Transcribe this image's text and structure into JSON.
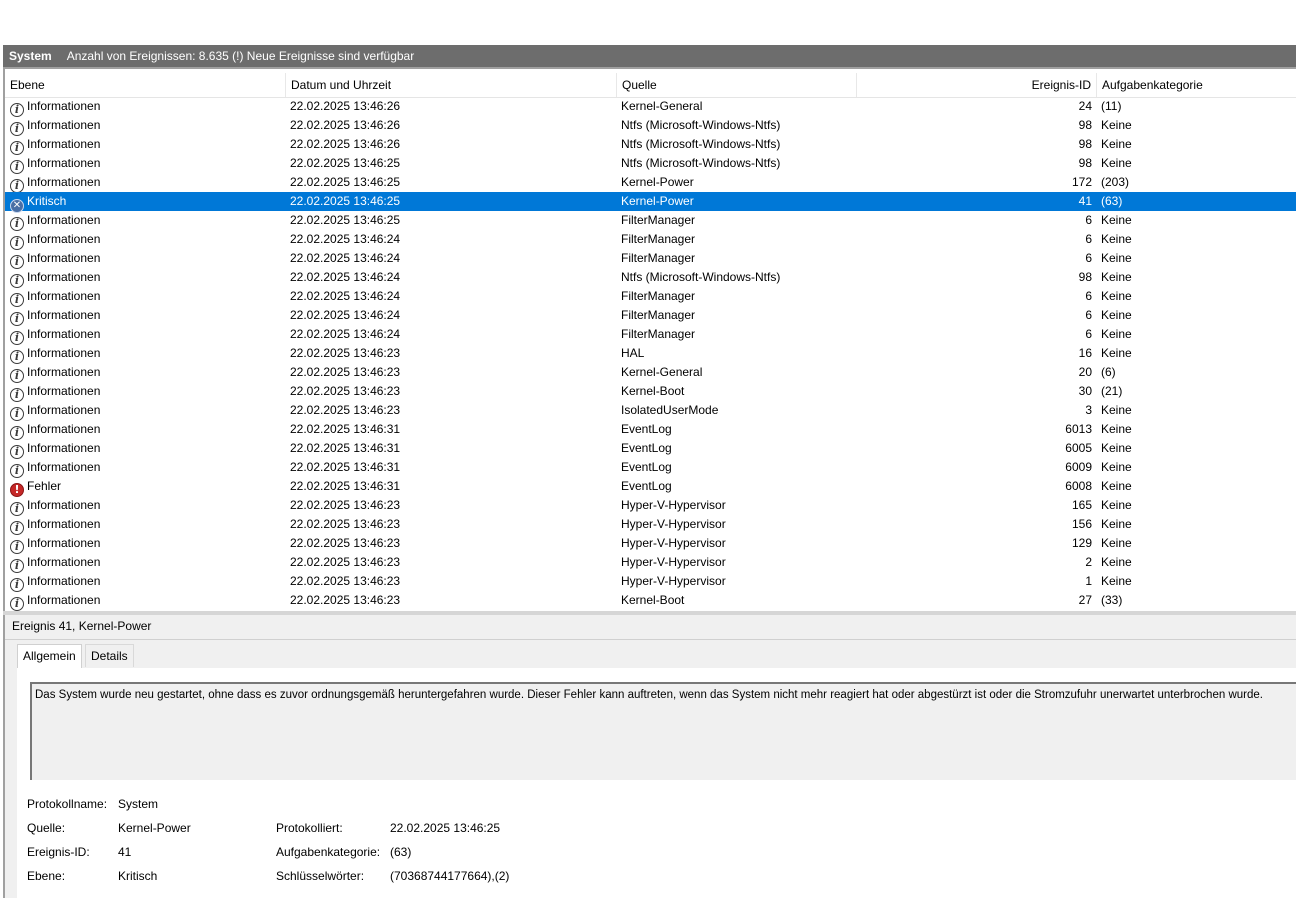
{
  "titlebar": {
    "log_name": "System",
    "summary": "Anzahl von Ereignissen: 8.635 (!) Neue Ereignisse sind verfügbar"
  },
  "columns": {
    "level": "Ebene",
    "date": "Datum und Uhrzeit",
    "source": "Quelle",
    "event_id": "Ereignis-ID",
    "category": "Aufgabenkategorie"
  },
  "rows": [
    {
      "level": "Informationen",
      "icon": "info-icon",
      "date": "22.02.2025 13:46:26",
      "source": "Kernel-General",
      "id": "24",
      "cat": "(11)"
    },
    {
      "level": "Informationen",
      "icon": "info-icon",
      "date": "22.02.2025 13:46:26",
      "source": "Ntfs (Microsoft-Windows-Ntfs)",
      "id": "98",
      "cat": "Keine"
    },
    {
      "level": "Informationen",
      "icon": "info-icon",
      "date": "22.02.2025 13:46:26",
      "source": "Ntfs (Microsoft-Windows-Ntfs)",
      "id": "98",
      "cat": "Keine"
    },
    {
      "level": "Informationen",
      "icon": "info-icon",
      "date": "22.02.2025 13:46:25",
      "source": "Ntfs (Microsoft-Windows-Ntfs)",
      "id": "98",
      "cat": "Keine"
    },
    {
      "level": "Informationen",
      "icon": "info-icon",
      "date": "22.02.2025 13:46:25",
      "source": "Kernel-Power",
      "id": "172",
      "cat": "(203)"
    },
    {
      "level": "Kritisch",
      "icon": "critical-icon",
      "date": "22.02.2025 13:46:25",
      "source": "Kernel-Power",
      "id": "41",
      "cat": "(63)",
      "selected": true
    },
    {
      "level": "Informationen",
      "icon": "info-icon",
      "date": "22.02.2025 13:46:25",
      "source": "FilterManager",
      "id": "6",
      "cat": "Keine"
    },
    {
      "level": "Informationen",
      "icon": "info-icon",
      "date": "22.02.2025 13:46:24",
      "source": "FilterManager",
      "id": "6",
      "cat": "Keine"
    },
    {
      "level": "Informationen",
      "icon": "info-icon",
      "date": "22.02.2025 13:46:24",
      "source": "FilterManager",
      "id": "6",
      "cat": "Keine"
    },
    {
      "level": "Informationen",
      "icon": "info-icon",
      "date": "22.02.2025 13:46:24",
      "source": "Ntfs (Microsoft-Windows-Ntfs)",
      "id": "98",
      "cat": "Keine"
    },
    {
      "level": "Informationen",
      "icon": "info-icon",
      "date": "22.02.2025 13:46:24",
      "source": "FilterManager",
      "id": "6",
      "cat": "Keine"
    },
    {
      "level": "Informationen",
      "icon": "info-icon",
      "date": "22.02.2025 13:46:24",
      "source": "FilterManager",
      "id": "6",
      "cat": "Keine"
    },
    {
      "level": "Informationen",
      "icon": "info-icon",
      "date": "22.02.2025 13:46:24",
      "source": "FilterManager",
      "id": "6",
      "cat": "Keine"
    },
    {
      "level": "Informationen",
      "icon": "info-icon",
      "date": "22.02.2025 13:46:23",
      "source": "HAL",
      "id": "16",
      "cat": "Keine"
    },
    {
      "level": "Informationen",
      "icon": "info-icon",
      "date": "22.02.2025 13:46:23",
      "source": "Kernel-General",
      "id": "20",
      "cat": "(6)"
    },
    {
      "level": "Informationen",
      "icon": "info-icon",
      "date": "22.02.2025 13:46:23",
      "source": "Kernel-Boot",
      "id": "30",
      "cat": "(21)"
    },
    {
      "level": "Informationen",
      "icon": "info-icon",
      "date": "22.02.2025 13:46:23",
      "source": "IsolatedUserMode",
      "id": "3",
      "cat": "Keine"
    },
    {
      "level": "Informationen",
      "icon": "info-icon",
      "date": "22.02.2025 13:46:31",
      "source": "EventLog",
      "id": "6013",
      "cat": "Keine"
    },
    {
      "level": "Informationen",
      "icon": "info-icon",
      "date": "22.02.2025 13:46:31",
      "source": "EventLog",
      "id": "6005",
      "cat": "Keine"
    },
    {
      "level": "Informationen",
      "icon": "info-icon",
      "date": "22.02.2025 13:46:31",
      "source": "EventLog",
      "id": "6009",
      "cat": "Keine"
    },
    {
      "level": "Fehler",
      "icon": "error-icon",
      "date": "22.02.2025 13:46:31",
      "source": "EventLog",
      "id": "6008",
      "cat": "Keine"
    },
    {
      "level": "Informationen",
      "icon": "info-icon",
      "date": "22.02.2025 13:46:23",
      "source": "Hyper-V-Hypervisor",
      "id": "165",
      "cat": "Keine"
    },
    {
      "level": "Informationen",
      "icon": "info-icon",
      "date": "22.02.2025 13:46:23",
      "source": "Hyper-V-Hypervisor",
      "id": "156",
      "cat": "Keine"
    },
    {
      "level": "Informationen",
      "icon": "info-icon",
      "date": "22.02.2025 13:46:23",
      "source": "Hyper-V-Hypervisor",
      "id": "129",
      "cat": "Keine"
    },
    {
      "level": "Informationen",
      "icon": "info-icon",
      "date": "22.02.2025 13:46:23",
      "source": "Hyper-V-Hypervisor",
      "id": "2",
      "cat": "Keine"
    },
    {
      "level": "Informationen",
      "icon": "info-icon",
      "date": "22.02.2025 13:46:23",
      "source": "Hyper-V-Hypervisor",
      "id": "1",
      "cat": "Keine"
    },
    {
      "level": "Informationen",
      "icon": "info-icon",
      "date": "22.02.2025 13:46:23",
      "source": "Kernel-Boot",
      "id": "27",
      "cat": "(33)"
    }
  ],
  "detail": {
    "title": "Ereignis 41, Kernel-Power",
    "tabs": [
      "Allgemein",
      "Details"
    ],
    "description": "Das System wurde neu gestartet, ohne dass es zuvor ordnungsgemäß heruntergefahren wurde. Dieser Fehler kann auftreten, wenn das System nicht mehr reagiert hat oder abgestürzt ist oder die Stromzufuhr unerwartet unterbrochen wurde.",
    "props": {
      "logname_label": "Protokollname:",
      "logname_value": "System",
      "source_label": "Quelle:",
      "source_value": "Kernel-Power",
      "logged_label": "Protokolliert:",
      "logged_value": "22.02.2025 13:46:25",
      "eventid_label": "Ereignis-ID:",
      "eventid_value": "41",
      "category_label": "Aufgabenkategorie:",
      "category_value": "(63)",
      "level_label": "Ebene:",
      "level_value": "Kritisch",
      "keywords_label": "Schlüsselwörter:",
      "keywords_value": "(70368744177664),(2)"
    }
  },
  "colors": {
    "selection": "#0078d7",
    "titlebar": "#6d6d6d",
    "panel": "#f0f0f0"
  }
}
